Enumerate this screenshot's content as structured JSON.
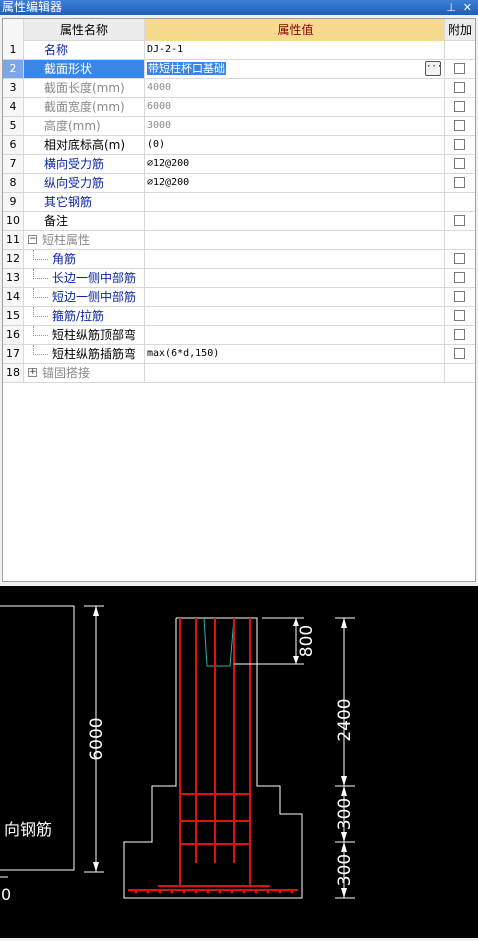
{
  "window": {
    "title": "属性编辑器",
    "pin_icon": "pin-icon",
    "close_icon": "close-icon"
  },
  "table": {
    "headers": {
      "name": "属性名称",
      "value": "属性值",
      "extra": "附加"
    },
    "rows": [
      {
        "num": "1",
        "name": "名称",
        "value": "DJ-2-1",
        "color": "blue",
        "checkbox": false
      },
      {
        "num": "2",
        "name": "截面形状",
        "value": "带短柱杯口基础",
        "color": "blue",
        "checkbox": true,
        "selected": true
      },
      {
        "num": "3",
        "name": "截面长度(mm)",
        "value": "4000",
        "color": "gray",
        "checkbox": true
      },
      {
        "num": "4",
        "name": "截面宽度(mm)",
        "value": "6000",
        "color": "gray",
        "checkbox": true
      },
      {
        "num": "5",
        "name": "高度(mm)",
        "value": "3000",
        "color": "gray",
        "checkbox": true
      },
      {
        "num": "6",
        "name": "相对底标高(m)",
        "value": "(0)",
        "color": "black",
        "checkbox": true
      },
      {
        "num": "7",
        "name": "横向受力筋",
        "value": "⌀12@200",
        "color": "blue",
        "checkbox": true
      },
      {
        "num": "8",
        "name": "纵向受力筋",
        "value": "⌀12@200",
        "color": "blue",
        "checkbox": true
      },
      {
        "num": "9",
        "name": "其它钢筋",
        "value": "",
        "color": "blue",
        "checkbox": false
      },
      {
        "num": "10",
        "name": "备注",
        "value": "",
        "color": "black",
        "checkbox": true
      },
      {
        "num": "11",
        "name": "短柱属性",
        "value": "",
        "color": "gray",
        "checkbox": false,
        "group": "minus"
      },
      {
        "num": "12",
        "name": "角筋",
        "value": "",
        "color": "blue",
        "checkbox": true,
        "child": true
      },
      {
        "num": "13",
        "name": "长边一侧中部筋",
        "value": "",
        "color": "blue",
        "checkbox": true,
        "child": true
      },
      {
        "num": "14",
        "name": "短边一侧中部筋",
        "value": "",
        "color": "blue",
        "checkbox": true,
        "child": true
      },
      {
        "num": "15",
        "name": "箍筋/拉筋",
        "value": "",
        "color": "blue",
        "checkbox": true,
        "child": true
      },
      {
        "num": "16",
        "name": "短柱纵筋顶部弯",
        "value": "",
        "color": "black",
        "checkbox": true,
        "child": true
      },
      {
        "num": "17",
        "name": "短柱纵筋插筋弯",
        "value": "max(6*d,150)",
        "color": "black",
        "checkbox": true,
        "child": true
      },
      {
        "num": "18",
        "name": "锚固搭接",
        "value": "",
        "color": "gray",
        "checkbox": false,
        "group": "plus"
      }
    ]
  },
  "cad": {
    "dims": {
      "d6000": "6000",
      "d800": "800",
      "d2400": "2400",
      "d300a": "300",
      "d300b": "300"
    },
    "label": "向钢筋",
    "zero": "0"
  }
}
